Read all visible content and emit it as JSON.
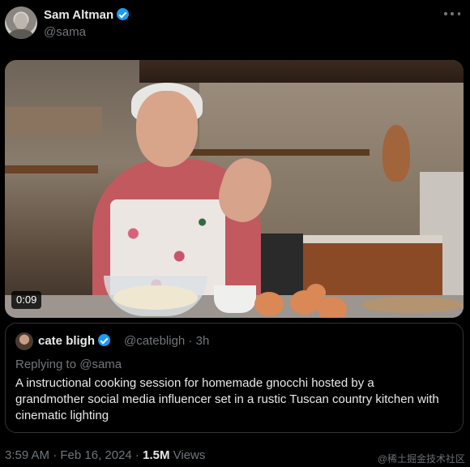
{
  "author": {
    "name": "Sam Altman",
    "handle": "@sama"
  },
  "media": {
    "duration": "0:09"
  },
  "quoted_tweet": {
    "name": "cate bligh",
    "meta": "@catebligh · 3h",
    "replying_to": "Replying to @sama",
    "text": "A instructional cooking session for homemade gnocchi hosted by a grandmother social media influencer set in a rustic Tuscan country kitchen with cinematic lighting"
  },
  "footer": {
    "timestamp": "3:59 AM · Feb 16, 2024 · ",
    "views_count": "1.5M",
    "views_label": " Views"
  },
  "watermark": "@稀土掘金技术社区",
  "colors": {
    "verified": "#1d9bf0",
    "background": "#000000",
    "secondary_text": "#71767b"
  }
}
